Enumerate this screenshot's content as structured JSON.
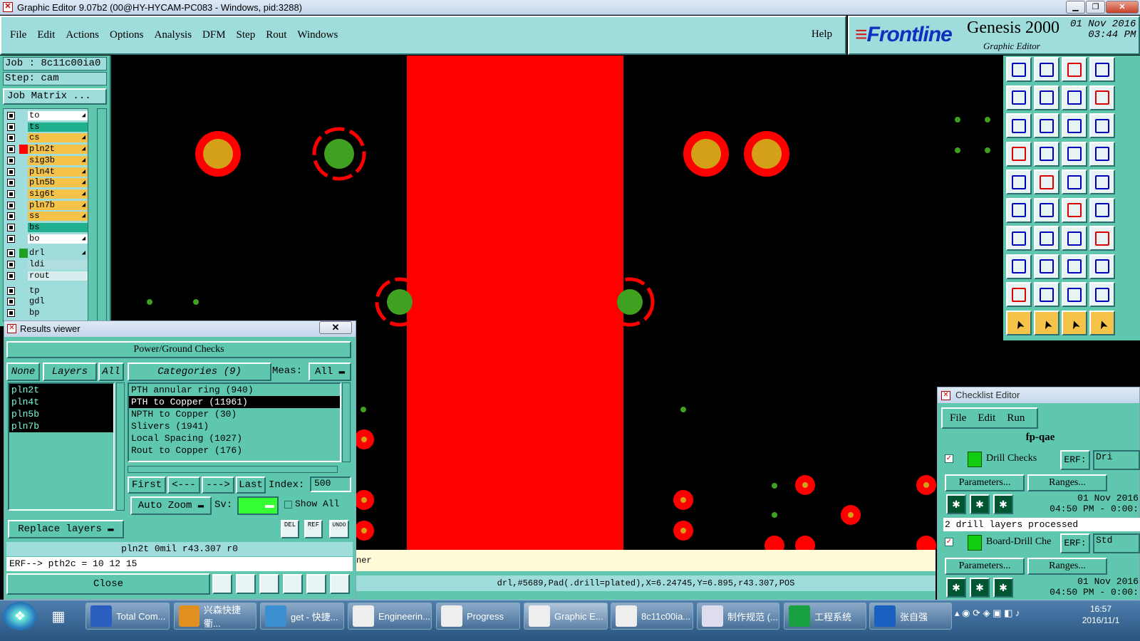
{
  "window": {
    "title": "Graphic Editor 9.07b2 (00@HY-HYCAM-PC083 - Windows, pid:3288)",
    "min": "▁",
    "max": "❐",
    "close": "✕"
  },
  "menu": {
    "items": [
      "File",
      "Edit",
      "Actions",
      "Options",
      "Analysis",
      "DFM",
      "Step",
      "Rout",
      "Windows"
    ],
    "help": "Help"
  },
  "brand": {
    "logo": "Frontline",
    "product": "Genesis 2000",
    "subtitle": "Graphic Editor",
    "date": "01 Nov 2016",
    "time": "03:44 PM"
  },
  "job": {
    "job": "Job : 8c11c00ia0",
    "step": "Step: cam",
    "matrix": "Job Matrix ..."
  },
  "layers": [
    {
      "name": "to",
      "color": "#ffffff",
      "arrow": true
    },
    {
      "name": "ts",
      "color": "#20b090",
      "arrow": false
    },
    {
      "name": "cs",
      "color": "#f5c24a",
      "arrow": true
    },
    {
      "name": "pln2t",
      "color": "#f5c24a",
      "arrow": true,
      "swatch": "#ff0000"
    },
    {
      "name": "sig3b",
      "color": "#f5c24a",
      "arrow": true
    },
    {
      "name": "pln4t",
      "color": "#f5c24a",
      "arrow": true
    },
    {
      "name": "pln5b",
      "color": "#f5c24a",
      "arrow": true
    },
    {
      "name": "sig6t",
      "color": "#f5c24a",
      "arrow": true
    },
    {
      "name": "pln7b",
      "color": "#f5c24a",
      "arrow": true
    },
    {
      "name": "ss",
      "color": "#f5c24a",
      "arrow": true
    },
    {
      "name": "bs",
      "color": "#20b090",
      "arrow": false
    },
    {
      "name": "bo",
      "color": "#ffffff",
      "arrow": true
    },
    {
      "name": "drl",
      "color": "#9fdcdc",
      "arrow": true,
      "swatch": "#20a020",
      "gap": true
    },
    {
      "name": "ldi",
      "color": "#b0dede",
      "arrow": false
    },
    {
      "name": "rout",
      "color": "#d8eeee",
      "arrow": false
    },
    {
      "name": "tp",
      "color": "#9fdcdc",
      "arrow": false,
      "gap": true
    },
    {
      "name": "gdl",
      "color": "#9fdcdc",
      "arrow": false
    },
    {
      "name": "bp",
      "color": "#9fdcdc",
      "arrow": false
    }
  ],
  "results": {
    "title": "Results viewer",
    "close": "✕",
    "section": "Power/Ground Checks",
    "none": "None",
    "layers_label": "Layers",
    "all": "All",
    "categories_label": "Categories (9)",
    "meas_label": "Meas:",
    "meas_value": "All",
    "layer_items": [
      "pln2t",
      "pln4t",
      "pln5b",
      "pln7b"
    ],
    "categories": [
      "PTH annular ring (940)",
      "PTH to Copper (11961)",
      "NPTH to Copper (30)",
      "Slivers (1941)",
      "Local Spacing (1027)",
      "Rout to Copper (176)"
    ],
    "nav": {
      "first": "First",
      "prev": "<---",
      "next": "--->",
      "last": "Last",
      "index_label": "Index:",
      "index_value": "500"
    },
    "auto_zoom": "Auto Zoom",
    "sv_label": "Sv:",
    "show_all": "Show All",
    "replace": "Replace layers",
    "del": "DEL",
    "ref": "REF",
    "undo": "UNDO",
    "info": "pln2t  0mil   r43.307  r0",
    "erf": "ERF--> pth2c = 10 12 15",
    "close_btn": "Close"
  },
  "status": {
    "ner": "ner",
    "line": "drl,#5689,Pad(.drill=plated),X=6.24745,Y=6.895,r43.307,POS"
  },
  "checklist": {
    "title": "Checklist Editor",
    "menu": [
      "File",
      "Edit",
      "Run"
    ],
    "name": "fp-qae",
    "checks": [
      {
        "name": "Drill Checks",
        "erf": "ERF:",
        "erf_val": "Dri",
        "params": "Parameters...",
        "ranges": "Ranges...",
        "date": "01 Nov 2016",
        "time": "04:50 PM - 0:00:",
        "status": "2 drill layers processed"
      },
      {
        "name": "Board-Drill Che",
        "erf": "ERF:",
        "erf_val": "Std",
        "params": "Parameters...",
        "ranges": "Ranges...",
        "date": "01 Nov 2016",
        "time": "04:50 PM - 0:00:"
      }
    ]
  },
  "taskbar": {
    "items": [
      "Total Com...",
      "兴森快捷衢...",
      "get - 快捷...",
      "Engineerin...",
      "Progress",
      "Graphic E...",
      "8c11c00ia...",
      "制作规范 (...",
      "工程系统",
      "张自强"
    ],
    "clock": "16:57",
    "date": "2016/11/1"
  },
  "colors": {
    "panel": "#5fc7ae",
    "menu": "#9fdcdc",
    "copper": "#ff0000",
    "pad": "#d4a018",
    "drill": "#40a020"
  }
}
